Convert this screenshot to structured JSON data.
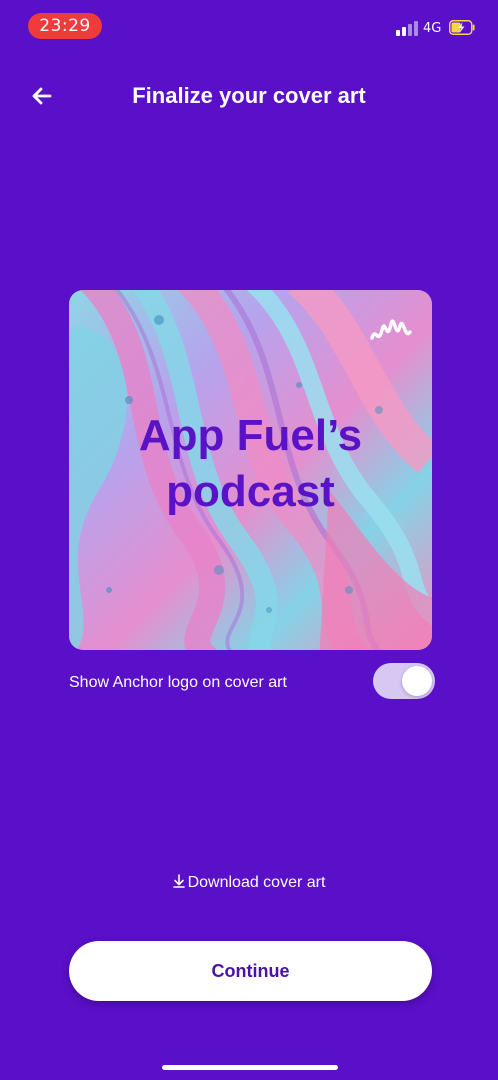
{
  "status_bar": {
    "time": "23:29",
    "network": "4G",
    "signal_icon": "cellular-signal-icon",
    "battery_icon": "battery-charging-icon"
  },
  "header": {
    "title": "Finalize your cover art",
    "back_icon": "arrow-left-icon"
  },
  "cover_art": {
    "title_line1": "App Fuel’s",
    "title_line2": "podcast",
    "logo_icon": "anchor-logo-icon"
  },
  "toggle": {
    "label": "Show Anchor logo on cover art",
    "checked": true
  },
  "download": {
    "label": "Download cover art",
    "icon": "download-icon"
  },
  "continue_button": {
    "label": "Continue"
  },
  "colors": {
    "background": "#5a0fc8",
    "cover_title": "#5a12c6",
    "button_text": "#4a12a8",
    "time_pill": "#ef3b3b",
    "toggle_track": "#d6c8f2"
  }
}
